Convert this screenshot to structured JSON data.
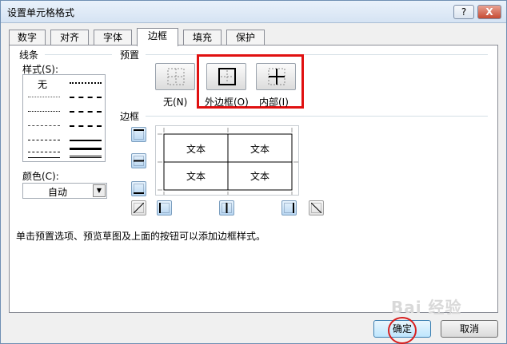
{
  "window": {
    "title": "设置单元格格式",
    "help_label": "?",
    "close_label": "X"
  },
  "tabs": [
    {
      "label": "数字"
    },
    {
      "label": "对齐"
    },
    {
      "label": "字体"
    },
    {
      "label": "边框",
      "active": true
    },
    {
      "label": "填充"
    },
    {
      "label": "保护"
    }
  ],
  "line_section": {
    "title": "线条",
    "style_label": "样式(S):",
    "none_label": "无",
    "color_label": "颜色(C):",
    "color_value": "自动"
  },
  "preset_section": {
    "title": "预置",
    "none_label": "无(N)",
    "outline_label": "外边框(O)",
    "inside_label": "内部(I)"
  },
  "border_section": {
    "title": "边框",
    "cells": [
      "文本",
      "文本",
      "文本",
      "文本"
    ]
  },
  "info_text": "单击预置选项、预览草图及上面的按钮可以添加边框样式。",
  "buttons": {
    "ok": "确定",
    "cancel": "取消"
  },
  "watermark": "Bai 经验",
  "colors": {
    "highlight": "#e01010",
    "title_bg": "#dbe6f4"
  }
}
